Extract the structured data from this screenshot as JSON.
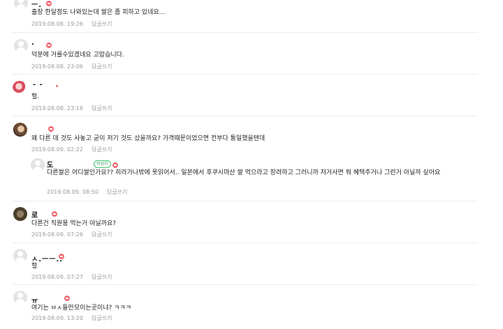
{
  "comments": [
    {
      "nick": "ㅡ.",
      "text": "출장 한달정도 나와있는데 쌀은 좀 피하고 있네요...",
      "date": "2019.08.08. 19:26",
      "reply": "답글쓰기"
    },
    {
      "nick": ".",
      "text": "덕분에 거를수있겠네요 고맙습니다.",
      "date": "2019.08.08. 23:06",
      "reply": "답글쓰기"
    },
    {
      "nick": "- -",
      "text": "헐.",
      "date": "2019.08.08. 23:18",
      "reply": "답글쓰기"
    },
    {
      "nick": "",
      "text": "왜 다른 데 것도 사놓고 굳이 저기 것도 샀을까요? 가격때문이었으면 전부다 통일했을텐데",
      "date": "2019.08.09. 02:22",
      "reply": "답글쓰기"
    },
    {
      "nick": "도",
      "writer_badge": "작성자",
      "text": "다른쌀은 어디쌀인가요?? 히라가나밖에 못읽어서.. 일본에서 후쿠시마산 쌀 먹으라고 장려하고 그러니까 저거사면 뭐 혜택주거나 그런거 아닐까 싶어요",
      "date": "2019.08.09. 08:50",
      "reply": "답글쓰기"
    },
    {
      "nick": "로",
      "text": "다른건 직원용 먹는거 아닐까요?",
      "date": "2019.08.09. 07:26",
      "reply": "답글쓰기"
    },
    {
      "nick": "ㅅ.ㅡㅡ..",
      "text": "헐",
      "date": "2019.08.09. 07:27",
      "reply": "답글쓰기"
    },
    {
      "nick": "ㅠ",
      "text": "여기는 ㅂㅅ들만모이는곳이냐? ㅋㅋㅋ",
      "date": "2019.08.09. 13:20",
      "reply": "답글쓰기"
    }
  ]
}
